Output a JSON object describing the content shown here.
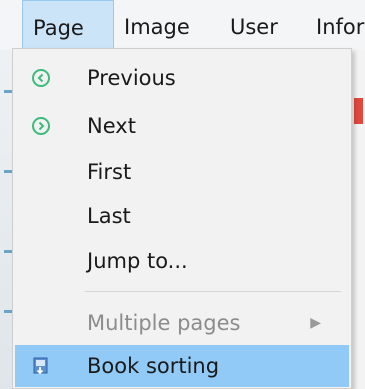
{
  "menubar": {
    "items": [
      {
        "label": "Page"
      },
      {
        "label": "Image"
      },
      {
        "label": "User"
      },
      {
        "label": "Infor"
      }
    ]
  },
  "page_menu": {
    "items": [
      {
        "label": "Previous",
        "icon": "circle-arrow-left-icon",
        "enabled": true
      },
      {
        "label": "Next",
        "icon": "circle-arrow-right-icon",
        "enabled": true
      },
      {
        "label": "First",
        "enabled": true
      },
      {
        "label": "Last",
        "enabled": true
      },
      {
        "label": "Jump to...",
        "enabled": true
      },
      {
        "label": "Multiple pages",
        "enabled": false,
        "submenu": true
      },
      {
        "label": "Book sorting",
        "icon": "book-sort-icon",
        "enabled": true,
        "highlighted": true
      }
    ]
  },
  "colors": {
    "icon_green": "#3dbb7d",
    "highlight": "#91c9f7",
    "menubar_active": "#cce4f7"
  }
}
